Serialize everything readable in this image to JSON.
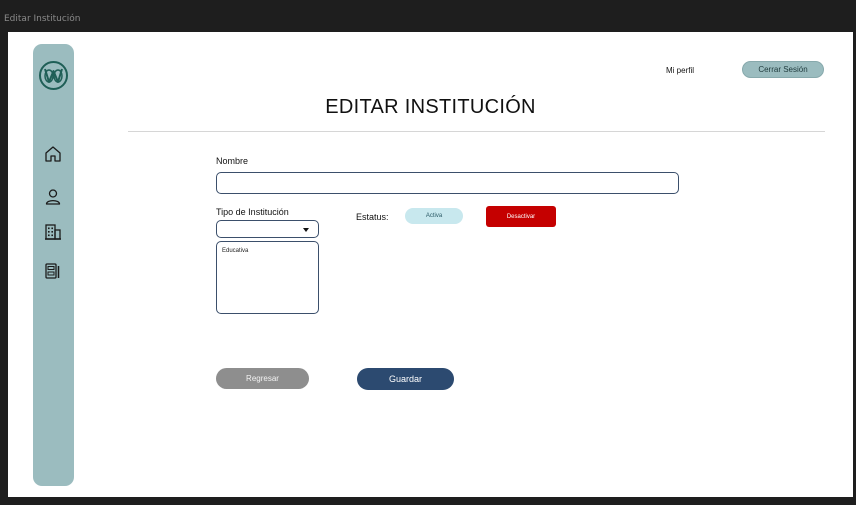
{
  "window": {
    "title": "Editar Institución"
  },
  "header": {
    "profile_link": "Mi perfil",
    "logout_label": "Cerrar Sesión"
  },
  "page": {
    "title": "EDITAR INSTITUCIÓN"
  },
  "sidebar": {
    "items": [
      {
        "icon": "home-icon"
      },
      {
        "icon": "user-icon"
      },
      {
        "icon": "building-icon"
      },
      {
        "icon": "inventory-icon"
      }
    ]
  },
  "form": {
    "name_label": "Nombre",
    "name_value": "",
    "type_label": "Tipo de Institución",
    "type_selected": "",
    "type_options": [
      "Educativa"
    ],
    "status_label": "Estatus:",
    "status_value": "Activa",
    "deactivate_label": "Desactivar",
    "back_label": "Regresar",
    "save_label": "Guardar"
  },
  "colors": {
    "sidebar": "#9bbcbf",
    "active_badge": "#c8e8ee",
    "deactivate": "#c50000",
    "save": "#2c4a70",
    "back": "#8e8e8e"
  }
}
